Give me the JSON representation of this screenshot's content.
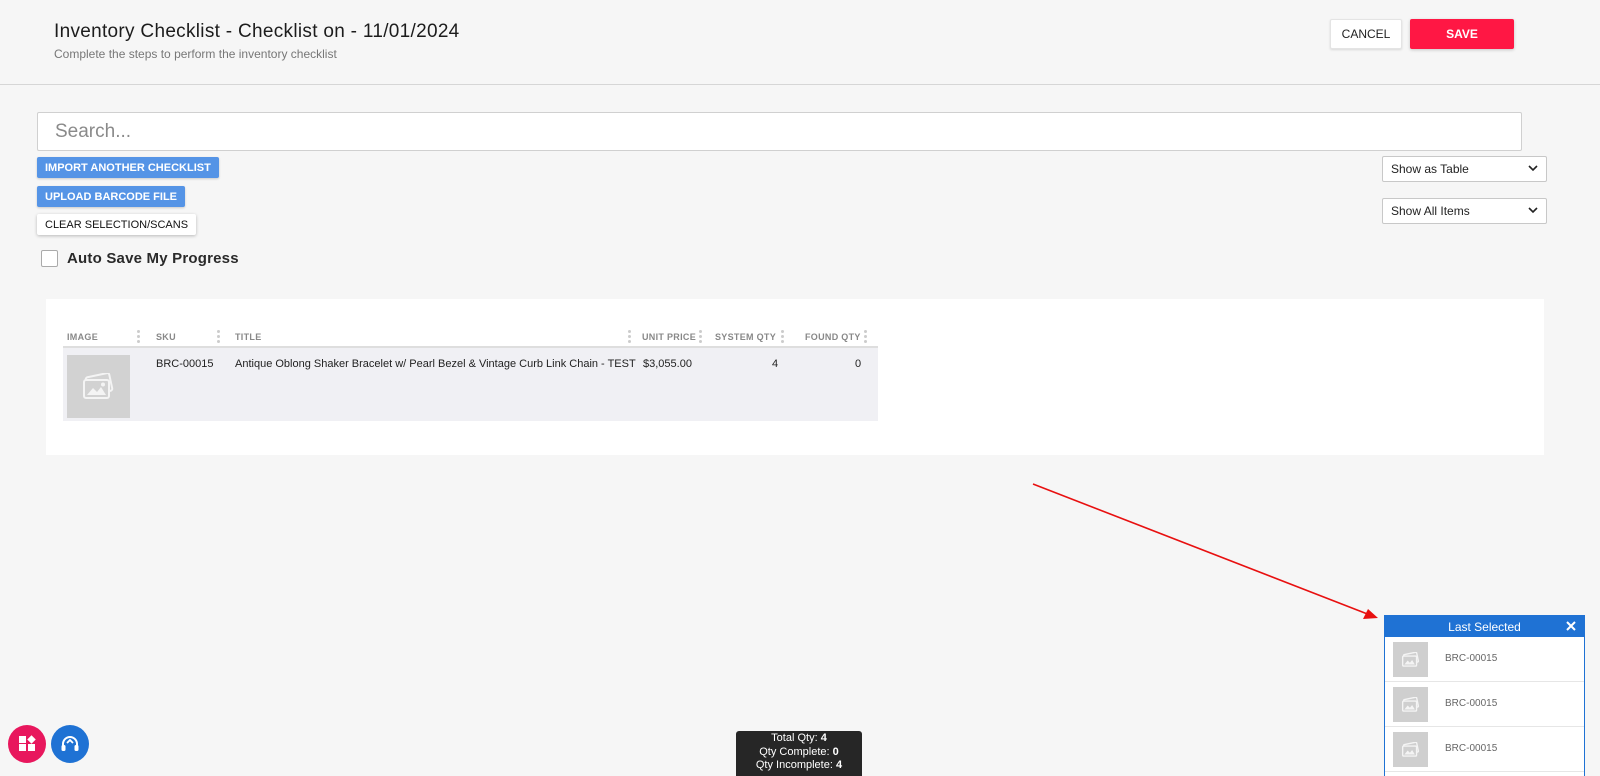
{
  "header": {
    "title": "Inventory Checklist - Checklist on - 11/01/2024",
    "subtitle": "Complete the steps to perform the inventory checklist",
    "cancel_label": "CANCEL",
    "save_label": "SAVE"
  },
  "search": {
    "placeholder": "Search..."
  },
  "actions": {
    "import_label": "IMPORT ANOTHER CHECKLIST",
    "upload_label": "UPLOAD BARCODE FILE",
    "clear_label": "CLEAR SELECTION/SCANS"
  },
  "autosave": {
    "label": "Auto Save My Progress",
    "checked": false
  },
  "view_select": {
    "selected": "Show as Table"
  },
  "filter_select": {
    "selected": "Show All Items"
  },
  "table": {
    "columns": [
      "IMAGE",
      "SKU",
      "TITLE",
      "UNIT PRICE",
      "SYSTEM QTY",
      "FOUND QTY"
    ],
    "rows": [
      {
        "image": "image-placeholder-icon",
        "sku": "BRC-00015",
        "title": "Antique Oblong Shaker Bracelet w/ Pearl Bezel & Vintage Curb Link Chain - TEST",
        "unit_price": "$3,055.00",
        "system_qty": "4",
        "found_qty": "0"
      }
    ]
  },
  "last_selected": {
    "title": "Last Selected",
    "items": [
      {
        "sku": "BRC-00015"
      },
      {
        "sku": "BRC-00015"
      },
      {
        "sku": "BRC-00015"
      }
    ]
  },
  "stats": {
    "total_label": "Total Qty:",
    "total_value": "4",
    "complete_label": "Qty Complete:",
    "complete_value": "0",
    "incomplete_label": "Qty Incomplete:",
    "incomplete_value": "4"
  },
  "colors": {
    "save": "#ff1744",
    "action_blue": "#5594e6",
    "panel_blue": "#1f72d4",
    "annotation_arrow": "#e81010",
    "fab_pink": "#e8175d"
  },
  "icons": [
    "chevron-down-icon",
    "image-placeholder-icon",
    "close-icon",
    "apps-icon",
    "support-headset-icon"
  ]
}
